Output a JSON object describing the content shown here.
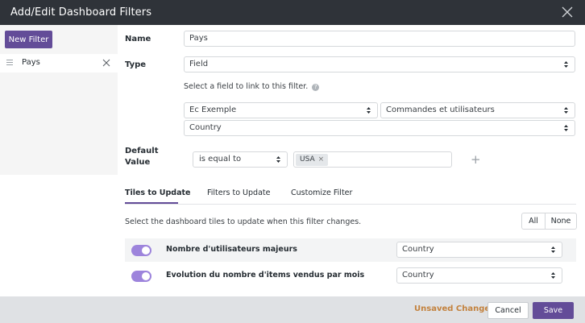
{
  "dialog": {
    "title": "Add/Edit Dashboard Filters",
    "close_icon": "close-icon"
  },
  "sidebar": {
    "new_filter_label": "New Filter",
    "filters": [
      {
        "name": "Pays"
      }
    ]
  },
  "form": {
    "name_label": "Name",
    "name_value": "Pays",
    "type_label": "Type",
    "type_value": "Field",
    "link_help": "Select a field to link to this filter.",
    "help_icon": "?",
    "model_value": "Ec Exemple",
    "explore_value": "Commandes et utilisateurs",
    "field_value": "Country",
    "default_label_line1": "Default",
    "default_label_line2": "Value",
    "operator_value": "is equal to",
    "value_token": "USA",
    "token_remove": "×",
    "add_symbol": "+"
  },
  "tabs": [
    {
      "label": "Tiles to Update",
      "active": true
    },
    {
      "label": "Filters to Update",
      "active": false
    },
    {
      "label": "Customize Filter",
      "active": false
    }
  ],
  "tiles": {
    "help": "Select the dashboard tiles to update when this filter changes.",
    "all_label": "All",
    "none_label": "None",
    "items": [
      {
        "name": "Nombre d'utilisateurs majeurs",
        "field": "Country",
        "enabled": true
      },
      {
        "name": "Evolution du nombre d'items vendus par mois",
        "field": "Country",
        "enabled": true
      }
    ]
  },
  "footer": {
    "unsaved": "Unsaved Changes",
    "cancel_label": "Cancel",
    "save_label": "Save"
  },
  "colors": {
    "header_bg": "#2f3339",
    "accent": "#634c98",
    "toggle_on": "#9d84dc",
    "unsaved": "#c3823e",
    "footer_bg": "#dfe1e4"
  }
}
